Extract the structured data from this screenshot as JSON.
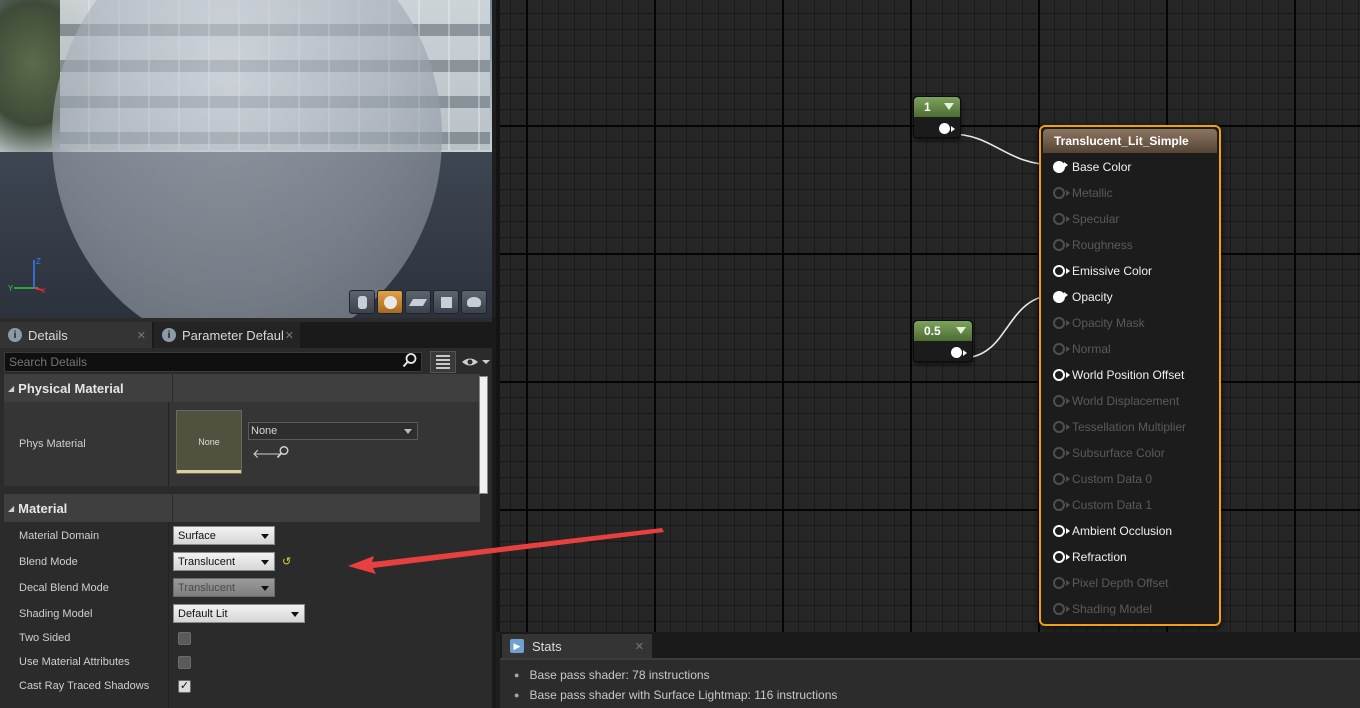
{
  "viewport": {
    "view_mode_buttons": [
      "cylinder-icon",
      "sphere-icon",
      "plane-icon",
      "cube-icon",
      "teapot-icon"
    ]
  },
  "details": {
    "tabs": [
      {
        "label": "Details",
        "icon": "info-icon",
        "active": true
      },
      {
        "label": "Parameter Defaults",
        "icon": "info-icon",
        "active": false
      }
    ],
    "search_placeholder": "Search Details",
    "physical_material": {
      "header": "Physical Material",
      "phys_material_label": "Phys Material",
      "thumbnail_text": "None",
      "combo_value": "None"
    },
    "material": {
      "header": "Material",
      "rows": [
        {
          "label": "Material Domain",
          "value": "Surface"
        },
        {
          "label": "Blend Mode",
          "value": "Translucent"
        },
        {
          "label": "Decal Blend Mode",
          "value": "Translucent"
        },
        {
          "label": "Shading Model",
          "value": "Default Lit"
        },
        {
          "label": "Two Sided",
          "checked": false
        },
        {
          "label": "Use Material Attributes",
          "checked": false
        },
        {
          "label": "Cast Ray Traced Shadows",
          "checked": true
        }
      ]
    }
  },
  "graph": {
    "constants": [
      {
        "value": "1"
      },
      {
        "value": "0.5"
      }
    ],
    "material_node": {
      "title": "Translucent_Lit_Simple",
      "pins": [
        {
          "label": "Base Color",
          "state": "connected"
        },
        {
          "label": "Metallic",
          "state": "disabled"
        },
        {
          "label": "Specular",
          "state": "disabled"
        },
        {
          "label": "Roughness",
          "state": "disabled"
        },
        {
          "label": "Emissive Color",
          "state": "enabled"
        },
        {
          "label": "Opacity",
          "state": "connected"
        },
        {
          "label": "Opacity Mask",
          "state": "disabled"
        },
        {
          "label": "Normal",
          "state": "disabled"
        },
        {
          "label": "World Position Offset",
          "state": "enabled"
        },
        {
          "label": "World Displacement",
          "state": "disabled"
        },
        {
          "label": "Tessellation Multiplier",
          "state": "disabled"
        },
        {
          "label": "Subsurface Color",
          "state": "disabled"
        },
        {
          "label": "Custom Data 0",
          "state": "disabled"
        },
        {
          "label": "Custom Data 1",
          "state": "disabled"
        },
        {
          "label": "Ambient Occlusion",
          "state": "enabled"
        },
        {
          "label": "Refraction",
          "state": "enabled"
        },
        {
          "label": "Pixel Depth Offset",
          "state": "disabled"
        },
        {
          "label": "Shading Model",
          "state": "disabled"
        }
      ]
    }
  },
  "stats": {
    "tab_label": "Stats",
    "lines": [
      "Base pass shader: 78 instructions",
      "Base pass shader with Surface Lightmap: 116 instructions"
    ]
  },
  "colors": {
    "node_selection": "#f0a010",
    "constant_header": "#6a9048",
    "annotation_arrow": "#e84040"
  }
}
